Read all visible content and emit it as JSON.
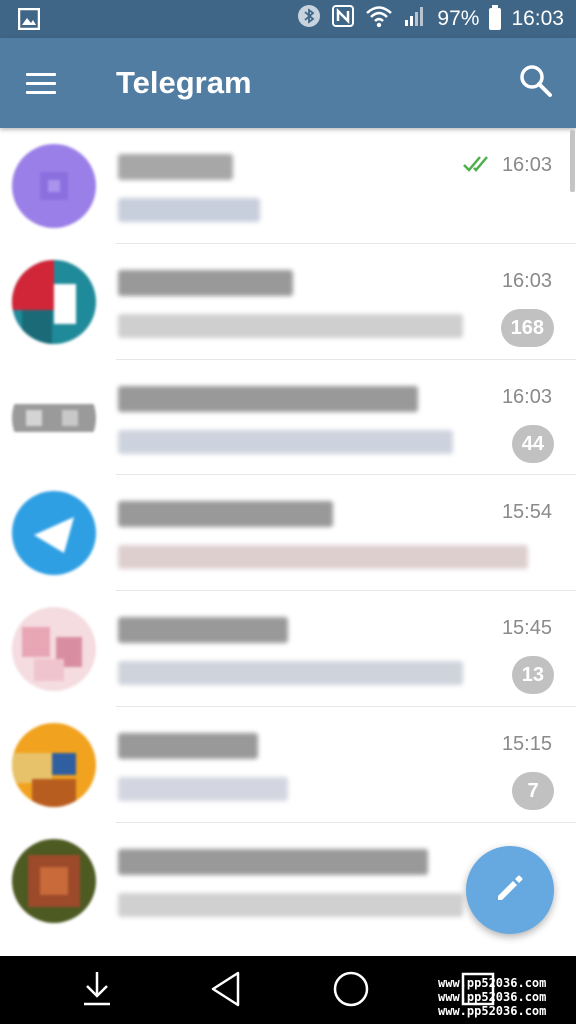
{
  "status_bar": {
    "battery": "97%",
    "clock": "16:03",
    "icons": [
      "gallery-icon",
      "bluetooth-icon",
      "nfc-icon",
      "wifi-icon",
      "signal-icon",
      "battery-icon"
    ]
  },
  "app_bar": {
    "title": "Telegram",
    "menu_icon": "hamburger-menu-icon",
    "search_icon": "search-icon"
  },
  "chats": [
    {
      "time": "16:03",
      "unread": "",
      "read_receipt": true,
      "avatar_colors": [
        "#9b7fe8",
        "#8c6fdf"
      ]
    },
    {
      "time": "16:03",
      "unread": "168",
      "read_receipt": false,
      "avatar_colors": [
        "#d02638",
        "#1f8a99"
      ]
    },
    {
      "time": "16:03",
      "unread": "44",
      "read_receipt": false,
      "avatar_colors": [
        "#9a9a9a",
        "#ffffff"
      ]
    },
    {
      "time": "15:54",
      "unread": "",
      "read_receipt": false,
      "avatar_colors": [
        "#2f9fe3",
        "#ffffff"
      ]
    },
    {
      "time": "15:45",
      "unread": "13",
      "read_receipt": false,
      "avatar_colors": [
        "#e8a6b5",
        "#f4dce0"
      ]
    },
    {
      "time": "15:15",
      "unread": "7",
      "read_receipt": false,
      "avatar_colors": [
        "#f1a21e",
        "#b85d20"
      ]
    },
    {
      "time": "",
      "unread": "",
      "read_receipt": false,
      "avatar_colors": [
        "#9c4a2a",
        "#4d5a22"
      ]
    }
  ],
  "fab": {
    "icon": "pencil-icon"
  },
  "nav_bar": {
    "icons": [
      "download-icon",
      "back-icon",
      "home-icon",
      "recents-icon"
    ],
    "watermark": [
      "www.pp52036.com",
      "www.pp52036.com",
      "www.pp52036.com"
    ]
  },
  "colors": {
    "status_bar": "#3f6587",
    "app_bar": "#527da3",
    "fab": "#65a9e0",
    "badge": "#c1c1c1",
    "read_check": "#4fae4e"
  }
}
